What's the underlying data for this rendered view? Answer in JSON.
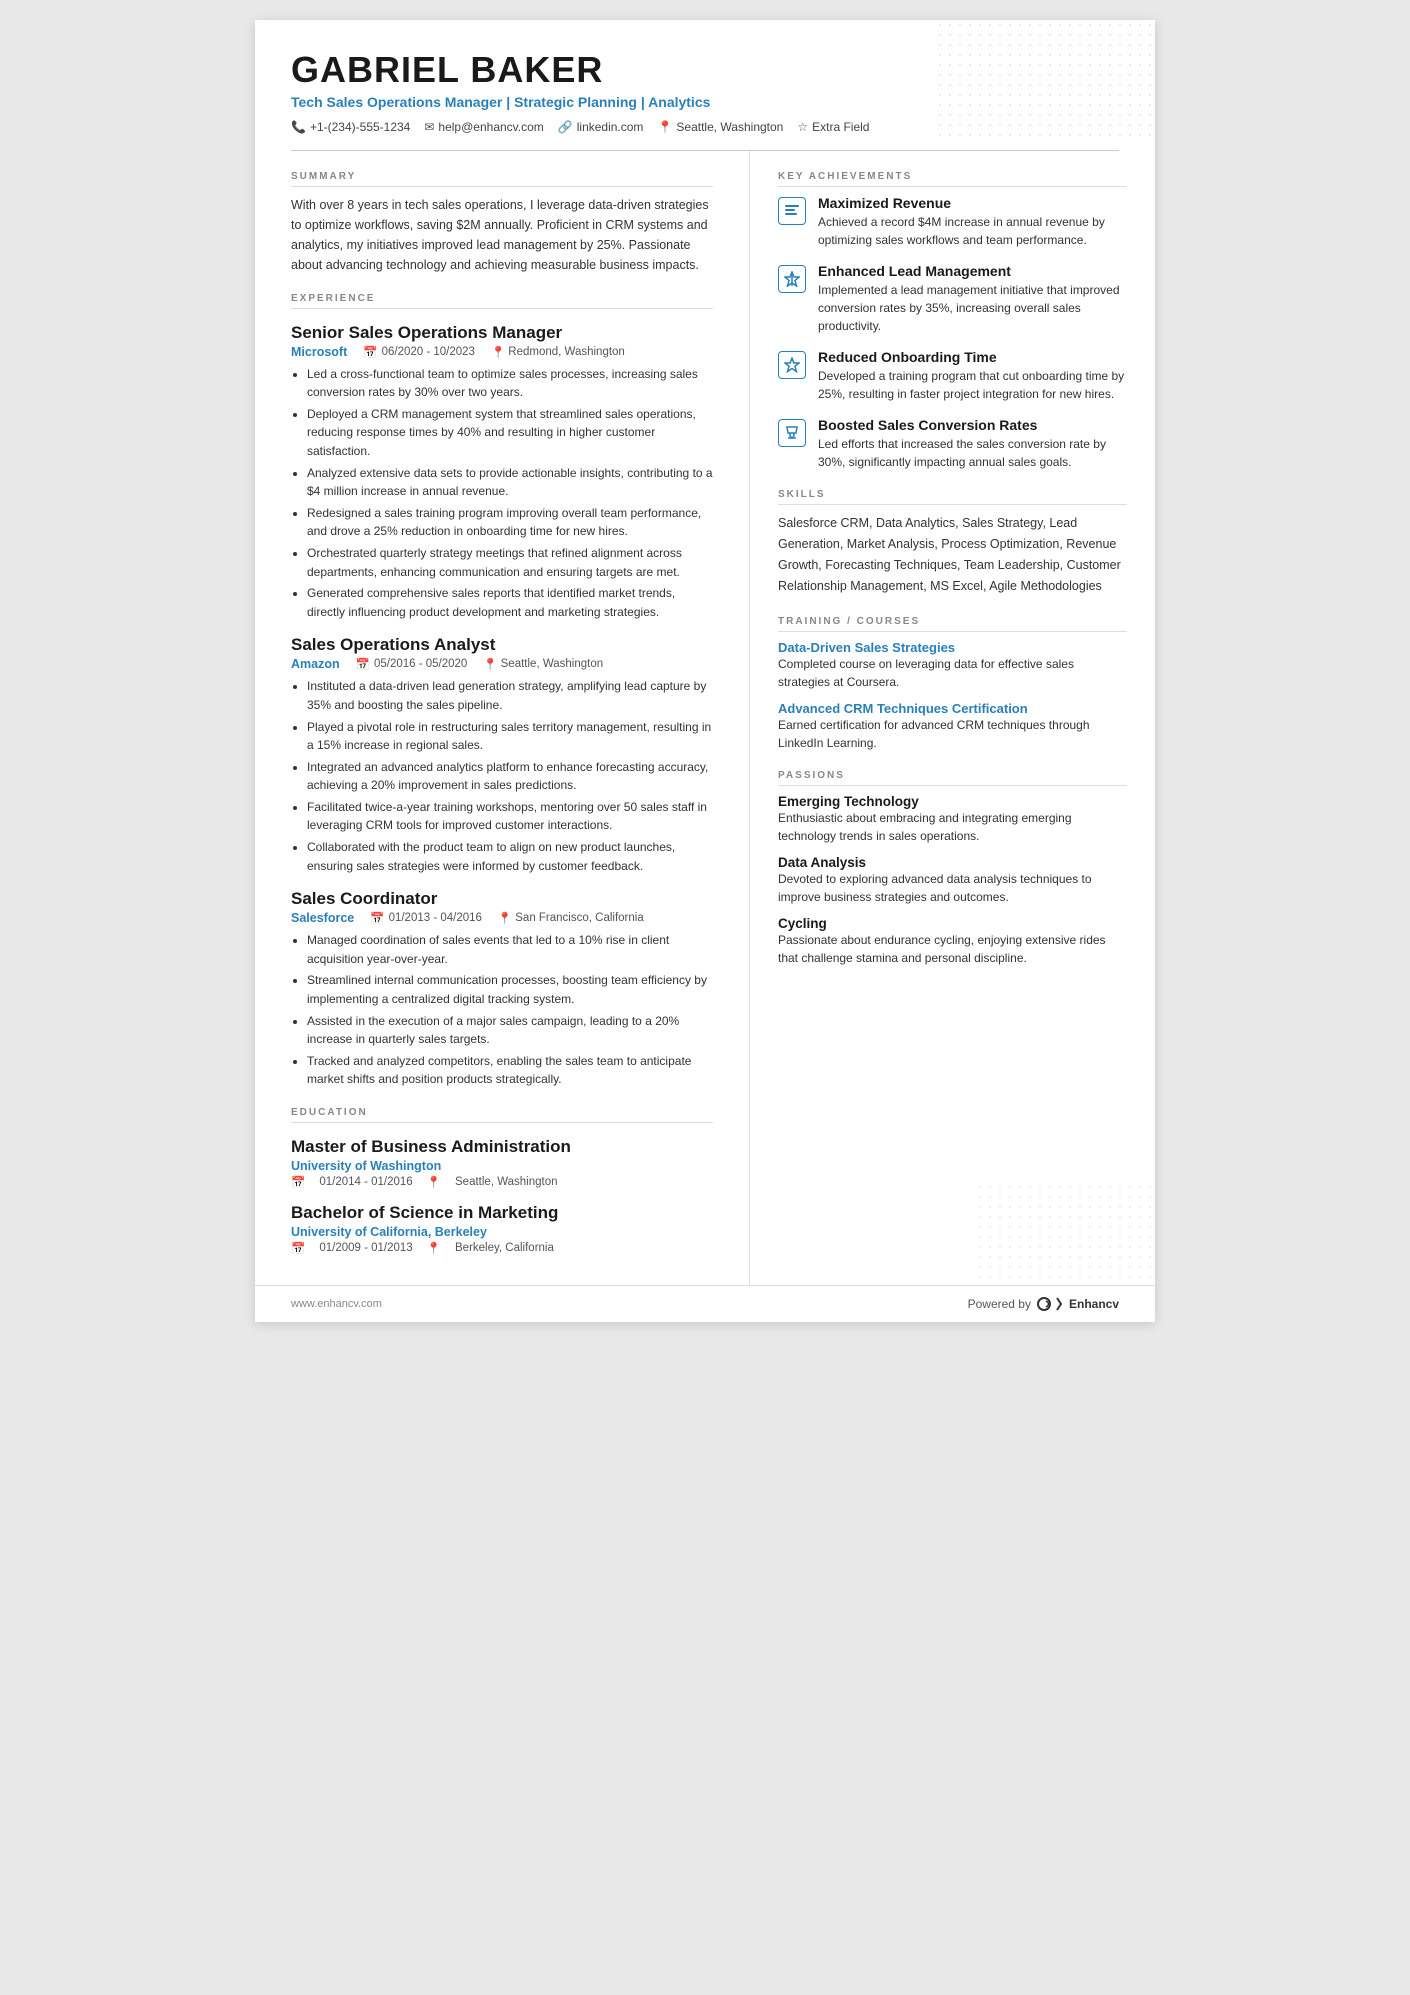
{
  "header": {
    "name": "GABRIEL BAKER",
    "subtitle": "Tech Sales Operations Manager | Strategic Planning | Analytics",
    "contact": {
      "phone": "+1-(234)-555-1234",
      "email": "help@enhancv.com",
      "linkedin": "linkedin.com",
      "location": "Seattle, Washington",
      "extra": "Extra Field"
    }
  },
  "summary": {
    "section_title": "SUMMARY",
    "text": "With over 8 years in tech sales operations, I leverage data-driven strategies to optimize workflows, saving $2M annually. Proficient in CRM systems and analytics, my initiatives improved lead management by 25%. Passionate about advancing technology and achieving measurable business impacts."
  },
  "experience": {
    "section_title": "EXPERIENCE",
    "jobs": [
      {
        "title": "Senior Sales Operations Manager",
        "company": "Microsoft",
        "dates": "06/2020 - 10/2023",
        "location": "Redmond, Washington",
        "bullets": [
          "Led a cross-functional team to optimize sales processes, increasing sales conversion rates by 30% over two years.",
          "Deployed a CRM management system that streamlined sales operations, reducing response times by 40% and resulting in higher customer satisfaction.",
          "Analyzed extensive data sets to provide actionable insights, contributing to a $4 million increase in annual revenue.",
          "Redesigned a sales training program improving overall team performance, and drove a 25% reduction in onboarding time for new hires.",
          "Orchestrated quarterly strategy meetings that refined alignment across departments, enhancing communication and ensuring targets are met.",
          "Generated comprehensive sales reports that identified market trends, directly influencing product development and marketing strategies."
        ]
      },
      {
        "title": "Sales Operations Analyst",
        "company": "Amazon",
        "dates": "05/2016 - 05/2020",
        "location": "Seattle, Washington",
        "bullets": [
          "Instituted a data-driven lead generation strategy, amplifying lead capture by 35% and boosting the sales pipeline.",
          "Played a pivotal role in restructuring sales territory management, resulting in a 15% increase in regional sales.",
          "Integrated an advanced analytics platform to enhance forecasting accuracy, achieving a 20% improvement in sales predictions.",
          "Facilitated twice-a-year training workshops, mentoring over 50 sales staff in leveraging CRM tools for improved customer interactions.",
          "Collaborated with the product team to align on new product launches, ensuring sales strategies were informed by customer feedback."
        ]
      },
      {
        "title": "Sales Coordinator",
        "company": "Salesforce",
        "dates": "01/2013 - 04/2016",
        "location": "San Francisco, California",
        "bullets": [
          "Managed coordination of sales events that led to a 10% rise in client acquisition year-over-year.",
          "Streamlined internal communication processes, boosting team efficiency by implementing a centralized digital tracking system.",
          "Assisted in the execution of a major sales campaign, leading to a 20% increase in quarterly sales targets.",
          "Tracked and analyzed competitors, enabling the sales team to anticipate market shifts and position products strategically."
        ]
      }
    ]
  },
  "education": {
    "section_title": "EDUCATION",
    "degrees": [
      {
        "title": "Master of Business Administration",
        "school": "University of Washington",
        "dates": "01/2014 - 01/2016",
        "location": "Seattle, Washington"
      },
      {
        "title": "Bachelor of Science in Marketing",
        "school": "University of California, Berkeley",
        "dates": "01/2009 - 01/2013",
        "location": "Berkeley, California"
      }
    ]
  },
  "key_achievements": {
    "section_title": "KEY ACHIEVEMENTS",
    "items": [
      {
        "icon": "📋",
        "title": "Maximized Revenue",
        "desc": "Achieved a record $4M increase in annual revenue by optimizing sales workflows and team performance."
      },
      {
        "icon": "⚡",
        "title": "Enhanced Lead Management",
        "desc": "Implemented a lead management initiative that improved conversion rates by 35%, increasing overall sales productivity."
      },
      {
        "icon": "⭐",
        "title": "Reduced Onboarding Time",
        "desc": "Developed a training program that cut onboarding time by 25%, resulting in faster project integration for new hires."
      },
      {
        "icon": "🏆",
        "title": "Boosted Sales Conversion Rates",
        "desc": "Led efforts that increased the sales conversion rate by 30%, significantly impacting annual sales goals."
      }
    ]
  },
  "skills": {
    "section_title": "SKILLS",
    "text": "Salesforce CRM, Data Analytics, Sales Strategy, Lead Generation, Market Analysis, Process Optimization, Revenue Growth, Forecasting Techniques, Team Leadership, Customer Relationship Management, MS Excel, Agile Methodologies"
  },
  "training": {
    "section_title": "TRAINING / COURSES",
    "items": [
      {
        "title": "Data-Driven Sales Strategies",
        "desc": "Completed course on leveraging data for effective sales strategies at Coursera."
      },
      {
        "title": "Advanced CRM Techniques Certification",
        "desc": "Earned certification for advanced CRM techniques through LinkedIn Learning."
      }
    ]
  },
  "passions": {
    "section_title": "PASSIONS",
    "items": [
      {
        "title": "Emerging Technology",
        "desc": "Enthusiastic about embracing and integrating emerging technology trends in sales operations."
      },
      {
        "title": "Data Analysis",
        "desc": "Devoted to exploring advanced data analysis techniques to improve business strategies and outcomes."
      },
      {
        "title": "Cycling",
        "desc": "Passionate about endurance cycling, enjoying extensive rides that challenge stamina and personal discipline."
      }
    ]
  },
  "footer": {
    "website": "www.enhancv.com",
    "powered_by": "Powered by",
    "brand": "Enhancv"
  }
}
